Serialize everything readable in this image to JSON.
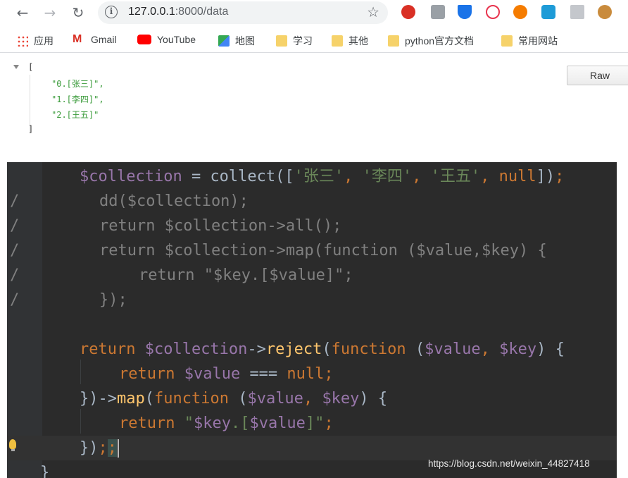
{
  "browser": {
    "url_host": "127.0.0.1",
    "url_path": ":8000/data",
    "bookmarks": [
      {
        "label": "应用",
        "icon": "apps-grid-icon"
      },
      {
        "label": "Gmail",
        "icon": "gmail-icon"
      },
      {
        "label": "YouTube",
        "icon": "youtube-icon"
      },
      {
        "label": "地图",
        "icon": "maps-icon"
      },
      {
        "label": "学习",
        "icon": "folder-icon"
      },
      {
        "label": "其他",
        "icon": "folder-icon"
      },
      {
        "label": "python官方文档",
        "icon": "folder-icon"
      },
      {
        "label": "常用网站",
        "icon": "folder-icon"
      }
    ],
    "extensions": [
      "adblock-icon",
      "extension-icon",
      "filter-icon",
      "play-icon",
      "infinity-icon",
      "hexagon-icon",
      "screenshot-icon",
      "cookie-icon"
    ]
  },
  "json_view": {
    "open_bracket": "[",
    "close_bracket": "]",
    "items": [
      "\"0.[张三]\",",
      "\"1.[李四]\",",
      "\"2.[王五]\""
    ],
    "raw_button": "Raw"
  },
  "code": {
    "comment_mark": "/"
  },
  "watermark": "https://blog.csdn.net/weixin_44827418"
}
